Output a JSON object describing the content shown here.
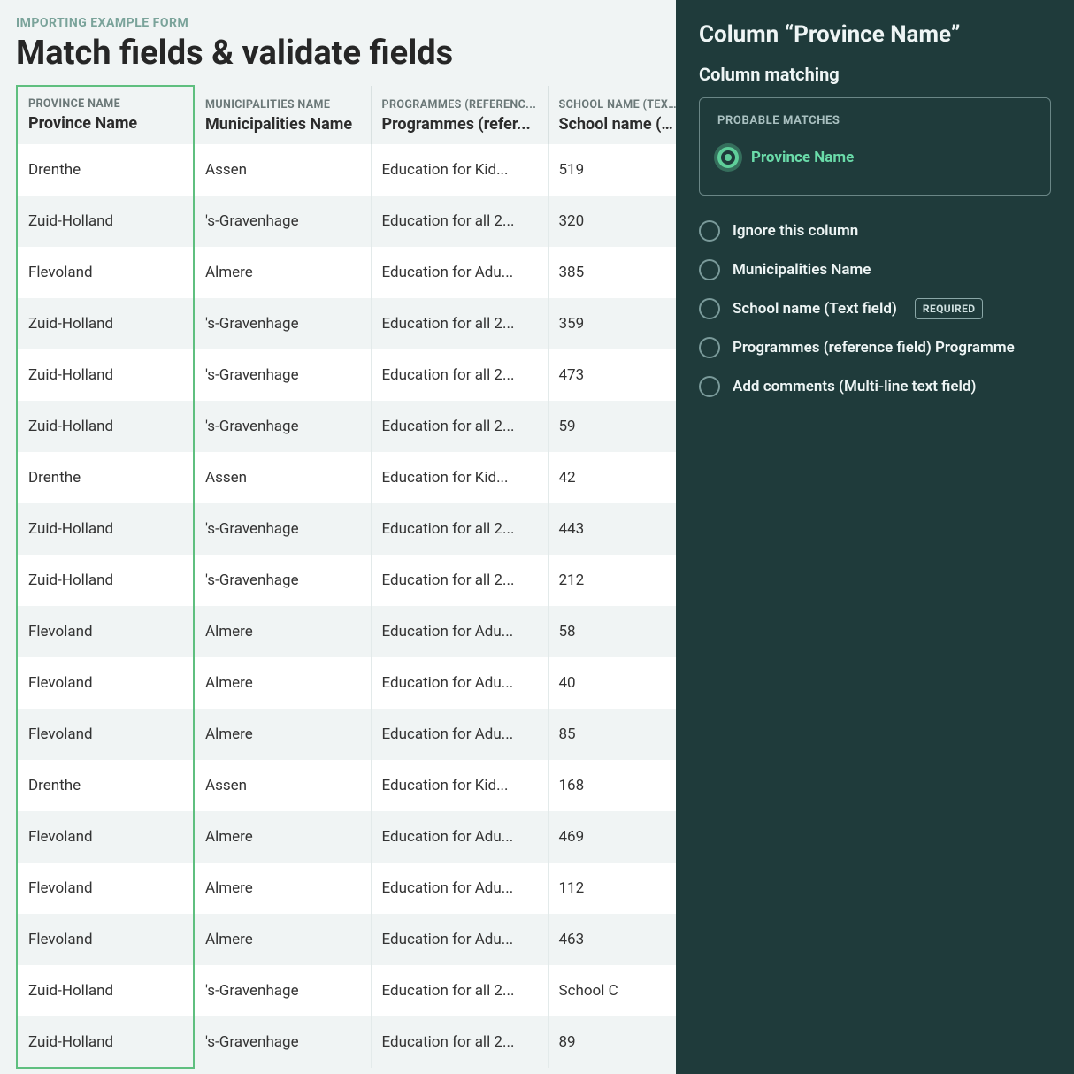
{
  "header": {
    "breadcrumb": "IMPORTING EXAMPLE FORM",
    "title": "Match fields & validate fields"
  },
  "columns": [
    {
      "source": "PROVINCE NAME",
      "mapped": "Province Name",
      "selected": true
    },
    {
      "source": "MUNICIPALITIES NAME",
      "mapped": "Municipalities Name",
      "selected": false
    },
    {
      "source": "PROGRAMMES (REFERENC...",
      "mapped": "Programmes (refer...",
      "selected": false
    },
    {
      "source": "SCHOOL NAME (TEXT F...",
      "mapped": "School name (Text...",
      "selected": false
    }
  ],
  "rows": [
    [
      "Drenthe",
      "Assen",
      "Education for Kid...",
      "519"
    ],
    [
      "Zuid-Holland",
      "'s-Gravenhage",
      "Education for all 2...",
      "320"
    ],
    [
      "Flevoland",
      "Almere",
      "Education for Adu...",
      "385"
    ],
    [
      "Zuid-Holland",
      "'s-Gravenhage",
      "Education for all 2...",
      "359"
    ],
    [
      "Zuid-Holland",
      "'s-Gravenhage",
      "Education for all 2...",
      "473"
    ],
    [
      "Zuid-Holland",
      "'s-Gravenhage",
      "Education for all 2...",
      "59"
    ],
    [
      "Drenthe",
      "Assen",
      "Education for Kid...",
      "42"
    ],
    [
      "Zuid-Holland",
      "'s-Gravenhage",
      "Education for all 2...",
      "443"
    ],
    [
      "Zuid-Holland",
      "'s-Gravenhage",
      "Education for all 2...",
      "212"
    ],
    [
      "Flevoland",
      "Almere",
      "Education for Adu...",
      "58"
    ],
    [
      "Flevoland",
      "Almere",
      "Education for Adu...",
      "40"
    ],
    [
      "Flevoland",
      "Almere",
      "Education for Adu...",
      "85"
    ],
    [
      "Drenthe",
      "Assen",
      "Education for Kid...",
      "168"
    ],
    [
      "Flevoland",
      "Almere",
      "Education for Adu...",
      "469"
    ],
    [
      "Flevoland",
      "Almere",
      "Education for Adu...",
      "112"
    ],
    [
      "Flevoland",
      "Almere",
      "Education for Adu...",
      "463"
    ],
    [
      "Zuid-Holland",
      "'s-Gravenhage",
      "Education for all 2...",
      "School C"
    ],
    [
      "Zuid-Holland",
      "'s-Gravenhage",
      "Education for all 2...",
      "89"
    ]
  ],
  "panel": {
    "title": "Column “Province Name”",
    "subtitle": "Column matching",
    "probable_label": "PROBABLE MATCHES",
    "options": [
      {
        "label": "Province Name",
        "selected": true,
        "required": false,
        "probable": true
      },
      {
        "label": "Ignore this column",
        "selected": false,
        "required": false,
        "probable": false
      },
      {
        "label": "Municipalities Name",
        "selected": false,
        "required": false,
        "probable": false
      },
      {
        "label": "School name (Text field)",
        "selected": false,
        "required": true,
        "probable": false
      },
      {
        "label": "Programmes (reference field) Programme",
        "selected": false,
        "required": false,
        "probable": false
      },
      {
        "label": "Add comments (Multi-line text field)",
        "selected": false,
        "required": false,
        "probable": false
      }
    ],
    "required_badge": "REQUIRED"
  }
}
